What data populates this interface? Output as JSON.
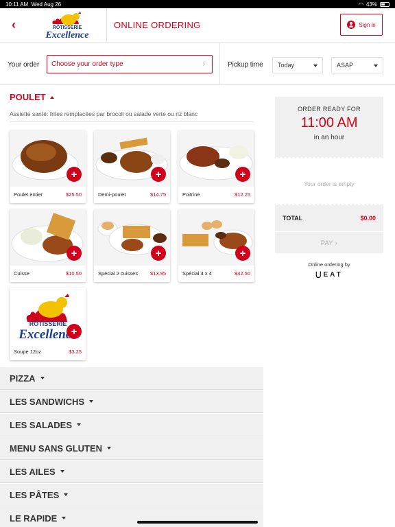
{
  "status_bar": {
    "time": "10:11 AM",
    "date": "Wed Aug 26",
    "battery": "43%"
  },
  "header": {
    "title": "ONLINE ORDERING",
    "sign_in_label": "Sign in",
    "logo_text_top": "RÔTISSERIE",
    "logo_text_bottom": "Excellence"
  },
  "order_bar": {
    "your_order_label": "Your order",
    "order_type_placeholder": "Choose your order type",
    "pickup_label": "Pickup time",
    "day_value": "Today",
    "time_value": "ASAP"
  },
  "menu": {
    "section_title": "POULET",
    "section_description": "Assiette santé: frites remplacées par brocoli ou salade verte ou riz blanc",
    "items": [
      {
        "name": "Poulet entier",
        "price": "$25.50"
      },
      {
        "name": "Demi-poulet",
        "price": "$14.75"
      },
      {
        "name": "Poitrine",
        "price": "$12.25"
      },
      {
        "name": "Cuisse",
        "price": "$10.50"
      },
      {
        "name": "Spécial 2 cuisses",
        "price": "$13.95"
      },
      {
        "name": "Spécial 4 x 4",
        "price": "$42.50"
      },
      {
        "name": "Soupe 12oz",
        "price": "$3.25"
      }
    ],
    "categories": [
      "PIZZA",
      "LES SANDWICHS",
      "LES SALADES",
      "MENU SANS GLUTEN",
      "LES AILES",
      "LES PÂTES",
      "LE RAPIDE"
    ]
  },
  "cart": {
    "ready_label": "ORDER READY FOR",
    "ready_time": "11:00 AM",
    "ready_eta": "in an hour",
    "empty_text": "Your order is empty",
    "total_label": "TOTAL",
    "total_value": "$0.00",
    "pay_label": "PAY ›",
    "powered_label": "Online ordering by",
    "powered_brand": "EAT"
  },
  "colors": {
    "accent": "#d0021b",
    "panel": "#f0f0f0"
  }
}
